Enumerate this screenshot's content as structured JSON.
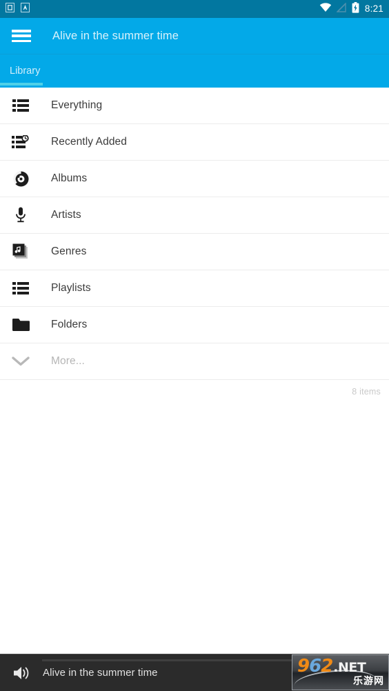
{
  "status_bar": {
    "left_icons": [
      "screenshot-icon",
      "font-size-icon"
    ],
    "right_icons": [
      "wifi-icon",
      "no-signal-icon",
      "battery-charging-icon"
    ],
    "time": "8:21",
    "background": "#0277a0"
  },
  "app_bar": {
    "menu_icon": "hamburger-menu-icon",
    "title": "Alive in the summer time",
    "background": "#03a9e8",
    "title_color": "#d9f2fb"
  },
  "tab_bar": {
    "tabs": [
      {
        "label": "Library",
        "selected": true
      }
    ],
    "indicator_color": "#4fd0e8"
  },
  "library": {
    "items": [
      {
        "label": "Everything",
        "icon": "list-icon",
        "muted": false
      },
      {
        "label": "Recently Added",
        "icon": "list-clock-icon",
        "muted": false
      },
      {
        "label": "Albums",
        "icon": "disc-icon",
        "muted": false
      },
      {
        "label": "Artists",
        "icon": "microphone-icon",
        "muted": false
      },
      {
        "label": "Genres",
        "icon": "album-stack-icon",
        "muted": false
      },
      {
        "label": "Playlists",
        "icon": "list-icon",
        "muted": false
      },
      {
        "label": "Folders",
        "icon": "folder-icon",
        "muted": false
      },
      {
        "label": "More...",
        "icon": "chevron-down-icon",
        "muted": true
      }
    ],
    "count_label": "8 items"
  },
  "player_bar": {
    "speaker_icon": "speaker-volume-icon",
    "title": "Alive in the summer time",
    "progress_percent": 0,
    "background": "#2b2b2b"
  },
  "watermark": {
    "digit_9": "9",
    "digit_6": "6",
    "digit_2": "2",
    "suffix": ".NET",
    "subtitle": "乐游网"
  }
}
